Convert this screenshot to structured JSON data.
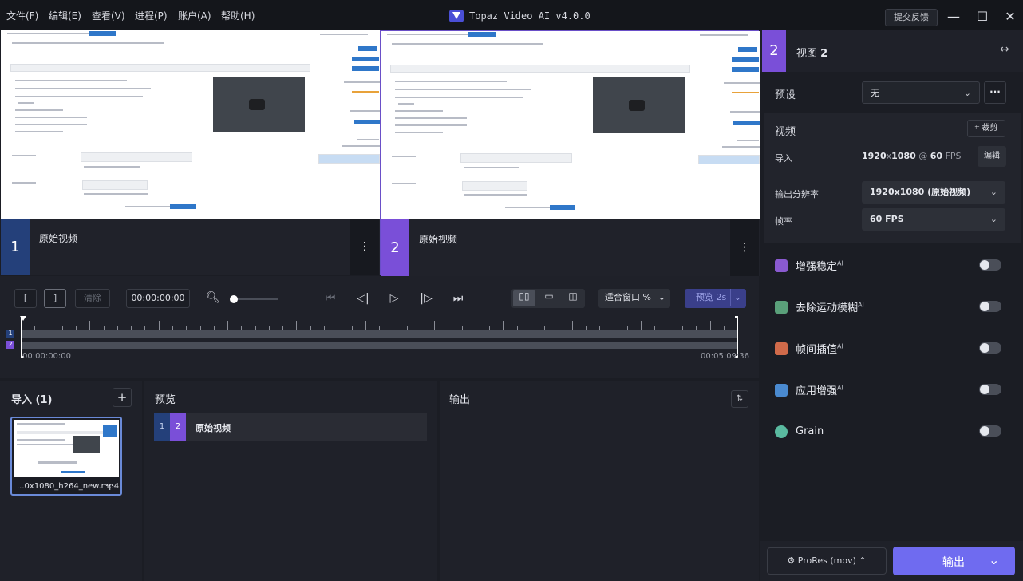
{
  "menu": [
    "文件(F)",
    "编辑(E)",
    "查看(V)",
    "进程(P)",
    "账户(A)",
    "帮助(H)"
  ],
  "app": {
    "title": "Topaz Video AI  v4.0.0",
    "feedback": "提交反馈"
  },
  "window_controls": {
    "minimize": "—",
    "maximize": "☐",
    "close": "✕"
  },
  "viewers": [
    {
      "number": "1",
      "label": "原始视频",
      "accent": "#24407a"
    },
    {
      "number": "2",
      "label": "原始视频",
      "accent": "#7a4fd8"
    }
  ],
  "controls": {
    "in_mark": "[",
    "out_mark": "]",
    "clear": "清除",
    "timecode": "00:00:00:00",
    "zoom": "适合窗口 %",
    "preview": "预览 2s",
    "time_start": "00:00:00:00",
    "time_end": "00:05:09:36",
    "tracks": [
      "1",
      "2"
    ]
  },
  "import_panel": {
    "title": "导入 (1)",
    "add": "+",
    "file_name": "...0x1080_h264_new.mp4",
    "more": "···"
  },
  "preview_panel": {
    "title": "预览",
    "item": {
      "n1": "1",
      "n2": "2",
      "label": "原始视频"
    }
  },
  "output_panel": {
    "title": "输出",
    "sort": "⇅"
  },
  "right": {
    "view_number": "2",
    "view_label": "视图",
    "view_label_num": "2",
    "preset_label": "预设",
    "preset_value": "无",
    "preset_more": "···",
    "video_label": "视频",
    "crop": "裁剪",
    "import_label": "导入",
    "import_res": "1920",
    "import_x": "x",
    "import_res2": "1080",
    "import_at": " @ ",
    "import_fps": "60",
    "import_fps_unit": " FPS",
    "edit": "编辑",
    "out_res_label": "输出分辨率",
    "out_res_value": "1920x1080 (原始视频)",
    "fps_label": "帧率",
    "fps_value": "60 FPS",
    "enhancements": [
      {
        "label": "增强稳定",
        "ai": "AI",
        "icon": "stabilize-icon",
        "color": "#8a5ad0",
        "on": false
      },
      {
        "label": "去除运动模糊",
        "ai": "AI",
        "icon": "motion-deblur-icon",
        "color": "#5aa07a",
        "on": false
      },
      {
        "label": "帧间插值",
        "ai": "AI",
        "icon": "frame-interpolation-icon",
        "color": "#d06a4a",
        "on": false
      },
      {
        "label": "应用增强",
        "ai": "AI",
        "icon": "enhancement-icon",
        "color": "#4a8ad0",
        "on": false
      },
      {
        "label": "Grain",
        "ai": "",
        "icon": "grain-icon",
        "color": "#5abaa0",
        "on": false
      }
    ],
    "format": "ProRes (mov)",
    "export": "输出"
  }
}
